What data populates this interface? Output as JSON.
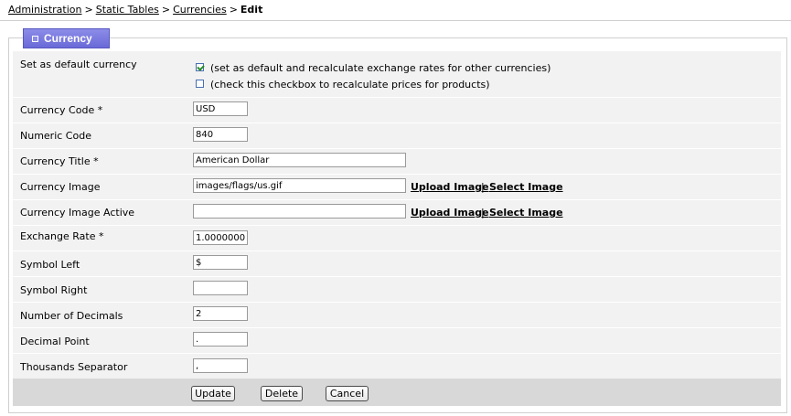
{
  "breadcrumb": {
    "items": [
      "Administration",
      "Static Tables",
      "Currencies"
    ],
    "separator": ">",
    "current": "Edit"
  },
  "section": {
    "tab_label": "Currency"
  },
  "form": {
    "default_currency": {
      "label": "Set as default currency",
      "option1": "(set as default and recalculate exchange rates for other currencies)",
      "option1_checked": true,
      "option2": "(check this checkbox to recalculate prices for products)",
      "option2_checked": false
    },
    "currency_code": {
      "label": "Currency Code *",
      "value": "USD"
    },
    "numeric_code": {
      "label": "Numeric Code",
      "value": "840"
    },
    "currency_title": {
      "label": "Currency Title *",
      "value": "American Dollar"
    },
    "currency_image": {
      "label": "Currency Image",
      "value": "images/flags/us.gif"
    },
    "currency_image_active": {
      "label": "Currency Image Active",
      "value": ""
    },
    "exchange_rate": {
      "label": "Exchange Rate *",
      "value": "1.00000000"
    },
    "symbol_left": {
      "label": "Symbol Left",
      "value": "$"
    },
    "symbol_right": {
      "label": "Symbol Right",
      "value": ""
    },
    "number_of_decimals": {
      "label": "Number of Decimals",
      "value": "2"
    },
    "decimal_point": {
      "label": "Decimal Point",
      "value": "."
    },
    "thousands_separator": {
      "label": "Thousands Separator",
      "value": ","
    },
    "upload_image_label": "Upload Image",
    "select_image_label": "Select Image",
    "link_separator": "|"
  },
  "buttons": {
    "update": "Update",
    "delete": "Delete",
    "cancel": "Cancel"
  },
  "colors": {
    "tab": "#7777dd",
    "row_bg": "#f2f2f2",
    "footer_bg": "#d8d8d8"
  },
  "icons": {
    "tab_icon": "square-icon",
    "checkbox": "checkbox-icon"
  }
}
